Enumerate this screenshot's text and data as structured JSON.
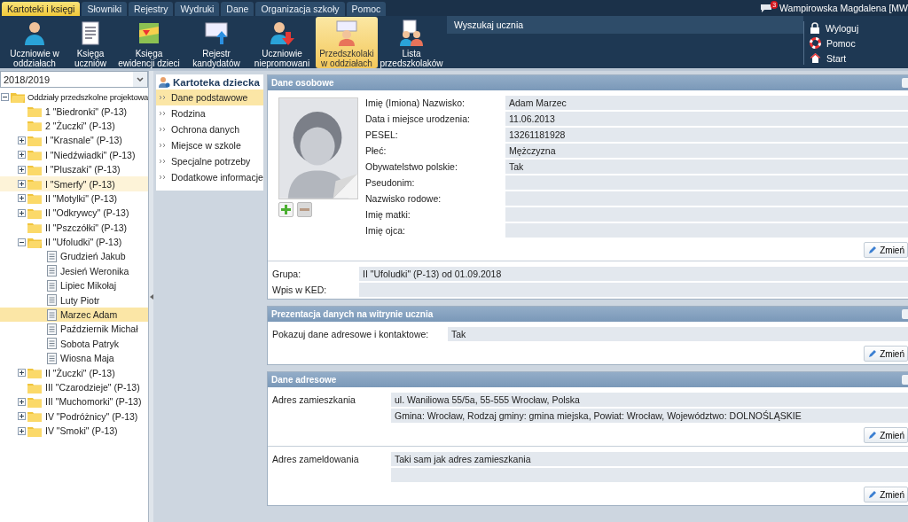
{
  "menu_tabs": [
    {
      "label": "Kartoteki i księgi",
      "selected": true
    },
    {
      "label": "Słowniki",
      "selected": false
    },
    {
      "label": "Rejestry",
      "selected": false
    },
    {
      "label": "Wydruki",
      "selected": false
    },
    {
      "label": "Dane",
      "selected": false
    },
    {
      "label": "Organizacja szkoły",
      "selected": false
    },
    {
      "label": "Pomoc",
      "selected": false
    }
  ],
  "user": {
    "badge": "3",
    "name": "Wampirowska Magdalena [MW"
  },
  "toolbar": {
    "buttons": [
      {
        "label": "Uczniowie w\noddziałach",
        "selected": false
      },
      {
        "label": "Księga\nuczniów",
        "selected": false
      },
      {
        "label": "Księga\newidencji dzieci",
        "selected": false
      },
      {
        "label": "Rejestr\nkandydatów",
        "selected": false
      },
      {
        "label": "Uczniowie\nniepromowani",
        "selected": false
      },
      {
        "label": "Przedszkolaki\nw oddziałach",
        "selected": true
      },
      {
        "label": "Lista\nprzedszkolaków",
        "selected": false
      }
    ],
    "search_label": "Wyszukaj ucznia",
    "links": [
      {
        "label": "Wyloguj"
      },
      {
        "label": "Pomoc"
      },
      {
        "label": "Start"
      }
    ]
  },
  "year_select": {
    "value": "2018/2019"
  },
  "tree": [
    {
      "label": "Oddziały przedszkolne projektowa",
      "kind": "root",
      "expanded": true,
      "selected": false,
      "children": [
        {
          "label": "1 \"Biedronki\" (P-13)",
          "kind": "group",
          "selected": false
        },
        {
          "label": "2 \"Żuczki\" (P-13)",
          "kind": "group",
          "selected": false
        },
        {
          "label": "I \"Krasnale\" (P-13)",
          "kind": "group",
          "expanded": false,
          "selected": false
        },
        {
          "label": "I \"Niedźwiadki\" (P-13)",
          "kind": "group",
          "expanded": false,
          "selected": false
        },
        {
          "label": "I \"Pluszaki\" (P-13)",
          "kind": "group",
          "expanded": false,
          "selected": false
        },
        {
          "label": "I \"Smerfy\" (P-13)",
          "kind": "group",
          "expanded": false,
          "selected": false,
          "hover": true
        },
        {
          "label": "II \"Motylki\" (P-13)",
          "kind": "group",
          "expanded": false,
          "selected": false
        },
        {
          "label": "II \"Odkrywcy\" (P-13)",
          "kind": "group",
          "expanded": false,
          "selected": false
        },
        {
          "label": "II \"Pszczółki\" (P-13)",
          "kind": "group",
          "selected": false
        },
        {
          "label": "II \"Ufoludki\" (P-13)",
          "kind": "group",
          "expanded": true,
          "selected": false,
          "children": [
            {
              "label": "Grudzień Jakub",
              "kind": "child",
              "selected": false
            },
            {
              "label": "Jesień Weronika",
              "kind": "child",
              "selected": false
            },
            {
              "label": "Lipiec Mikołaj",
              "kind": "child",
              "selected": false
            },
            {
              "label": "Luty Piotr",
              "kind": "child",
              "selected": false
            },
            {
              "label": "Marzec Adam",
              "kind": "child",
              "selected": true
            },
            {
              "label": "Październik Michał",
              "kind": "child",
              "selected": false
            },
            {
              "label": "Sobota Patryk",
              "kind": "child",
              "selected": false
            },
            {
              "label": "Wiosna Maja",
              "kind": "child",
              "selected": false
            }
          ]
        },
        {
          "label": "II \"Żuczki\" (P-13)",
          "kind": "group",
          "expanded": false,
          "selected": false
        },
        {
          "label": "III \"Czarodzieje\" (P-13)",
          "kind": "group",
          "selected": false
        },
        {
          "label": "III \"Muchomorki\" (P-13)",
          "kind": "group",
          "expanded": false,
          "selected": false
        },
        {
          "label": "IV \"Podróżnicy\" (P-13)",
          "kind": "group",
          "expanded": false,
          "selected": false
        },
        {
          "label": "IV \"Smoki\" (P-13)",
          "kind": "group",
          "expanded": false,
          "selected": false
        }
      ]
    }
  ],
  "record_nav": {
    "title": "Kartoteka dziecka",
    "items": [
      {
        "label": "Dane podstawowe",
        "selected": true
      },
      {
        "label": "Rodzina",
        "selected": false
      },
      {
        "label": "Ochrona danych",
        "selected": false
      },
      {
        "label": "Miejsce w szkole",
        "selected": false
      },
      {
        "label": "Specjalne potrzeby",
        "selected": false
      },
      {
        "label": "Dodatkowe informacje",
        "selected": false
      }
    ]
  },
  "personal": {
    "title": "Dane osobowe",
    "fields": [
      {
        "label": "Imię (Imiona) Nazwisko:",
        "value": "Adam Marzec"
      },
      {
        "label": "Data i miejsce urodzenia:",
        "value": "11.06.2013"
      },
      {
        "label": "PESEL:",
        "value": "13261181928"
      },
      {
        "label": "Płeć:",
        "value": "Mężczyzna"
      },
      {
        "label": "Obywatelstwo polskie:",
        "value": "Tak"
      },
      {
        "label": "Pseudonim:"
      },
      {
        "label": "Nazwisko rodowe:"
      },
      {
        "label": "Imię matki:"
      },
      {
        "label": "Imię ojca:"
      }
    ],
    "change_button": "Zmień",
    "group_fields": [
      {
        "label": "Grupa:",
        "value": "II \"Ufoludki\" (P-13)  od 01.09.2018"
      },
      {
        "label": "Wpis w KED:"
      }
    ]
  },
  "presentation": {
    "title": "Prezentacja danych na witrynie ucznia",
    "fields": [
      {
        "label": "Pokazuj dane adresowe i kontaktowe:",
        "value": "Tak"
      }
    ],
    "change_button": "Zmień"
  },
  "address": {
    "title": "Dane adresowe",
    "blocks": [
      {
        "label": "Adres zamieszkania",
        "lines": [
          "ul. Waniliowa 55/5a, 55-555 Wrocław, Polska",
          "Gmina: Wrocław, Rodzaj gminy: gmina miejska, Powiat: Wrocław, Województwo: DOLNOŚLĄSKIE"
        ],
        "change_button": "Zmień"
      },
      {
        "label": "Adres zameldowania",
        "lines": [
          "Taki sam jak adres zamieszkania"
        ],
        "change_button": "Zmień"
      }
    ]
  }
}
